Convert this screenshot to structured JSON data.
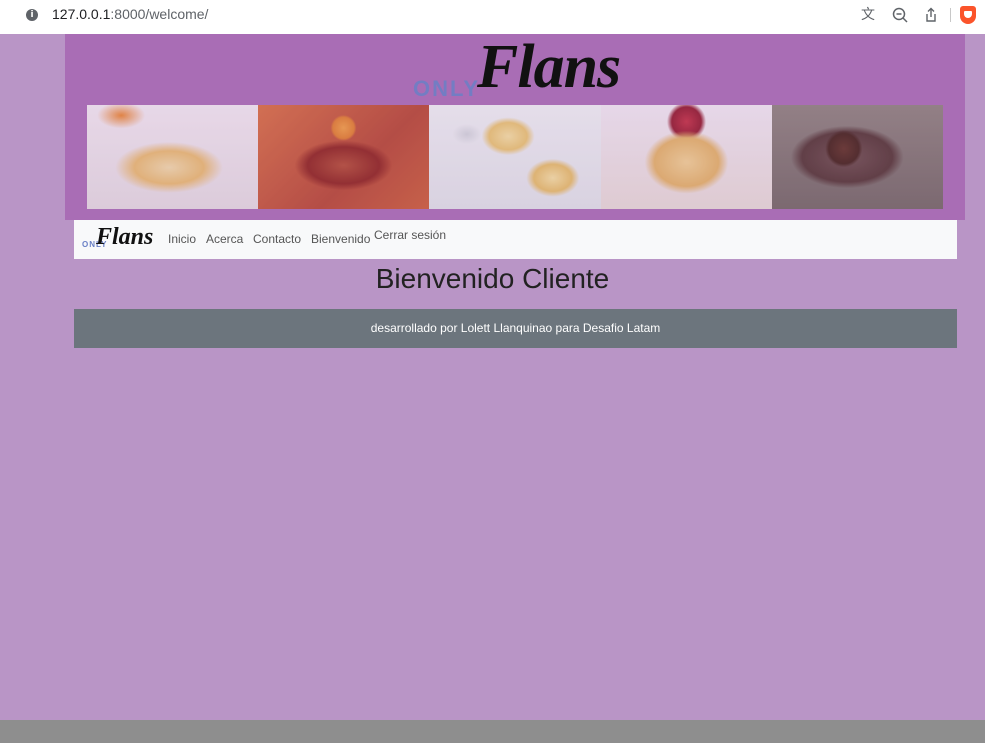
{
  "browser": {
    "url_host": "127.0.0.1",
    "url_rest": ":8000/welcome/",
    "icons": [
      "info-icon",
      "translate-icon",
      "zoom-out-icon",
      "share-icon",
      "brave-icon"
    ]
  },
  "header": {
    "logo_small": "ONLY",
    "logo_large": "Flans"
  },
  "navbar": {
    "brand_small": "ONLY",
    "brand_large": "Flans",
    "links": [
      "Inicio",
      "Acerca",
      "Contacto",
      "Bienvenido",
      "Cerrar sesión"
    ]
  },
  "main": {
    "title": "Bienvenido Cliente"
  },
  "footer": {
    "text": "desarrollado por Lolett Llanquinao para Desafio Latam"
  },
  "colors": {
    "page_bg": "#b995c6",
    "header_bg": "#a96db5",
    "navbar_bg": "#f8f9fa",
    "footer_bg": "#6c757d"
  }
}
